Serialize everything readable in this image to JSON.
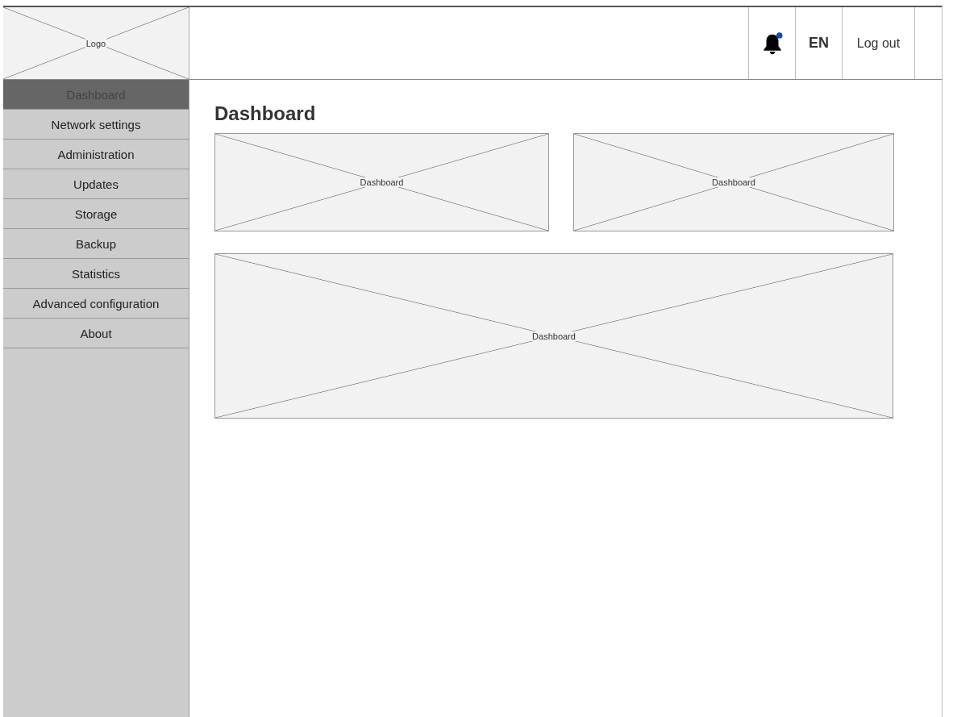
{
  "logo": {
    "label": "Logo"
  },
  "header": {
    "notifications": {
      "unread": true
    },
    "language": "EN",
    "logout": "Log out"
  },
  "sidebar": {
    "items": [
      {
        "label": "Dashboard",
        "selected": true
      },
      {
        "label": "Network settings",
        "selected": false
      },
      {
        "label": "Administration",
        "selected": false
      },
      {
        "label": "Updates",
        "selected": false
      },
      {
        "label": "Storage",
        "selected": false
      },
      {
        "label": "Backup",
        "selected": false
      },
      {
        "label": "Statistics",
        "selected": false
      },
      {
        "label": "Advanced configuration",
        "selected": false
      },
      {
        "label": "About",
        "selected": false
      }
    ]
  },
  "main": {
    "title": "Dashboard",
    "panels": [
      {
        "label": "Dashboard",
        "kind": "half"
      },
      {
        "label": "Dashboard",
        "kind": "half"
      },
      {
        "label": "Dashboard",
        "kind": "full"
      }
    ]
  }
}
